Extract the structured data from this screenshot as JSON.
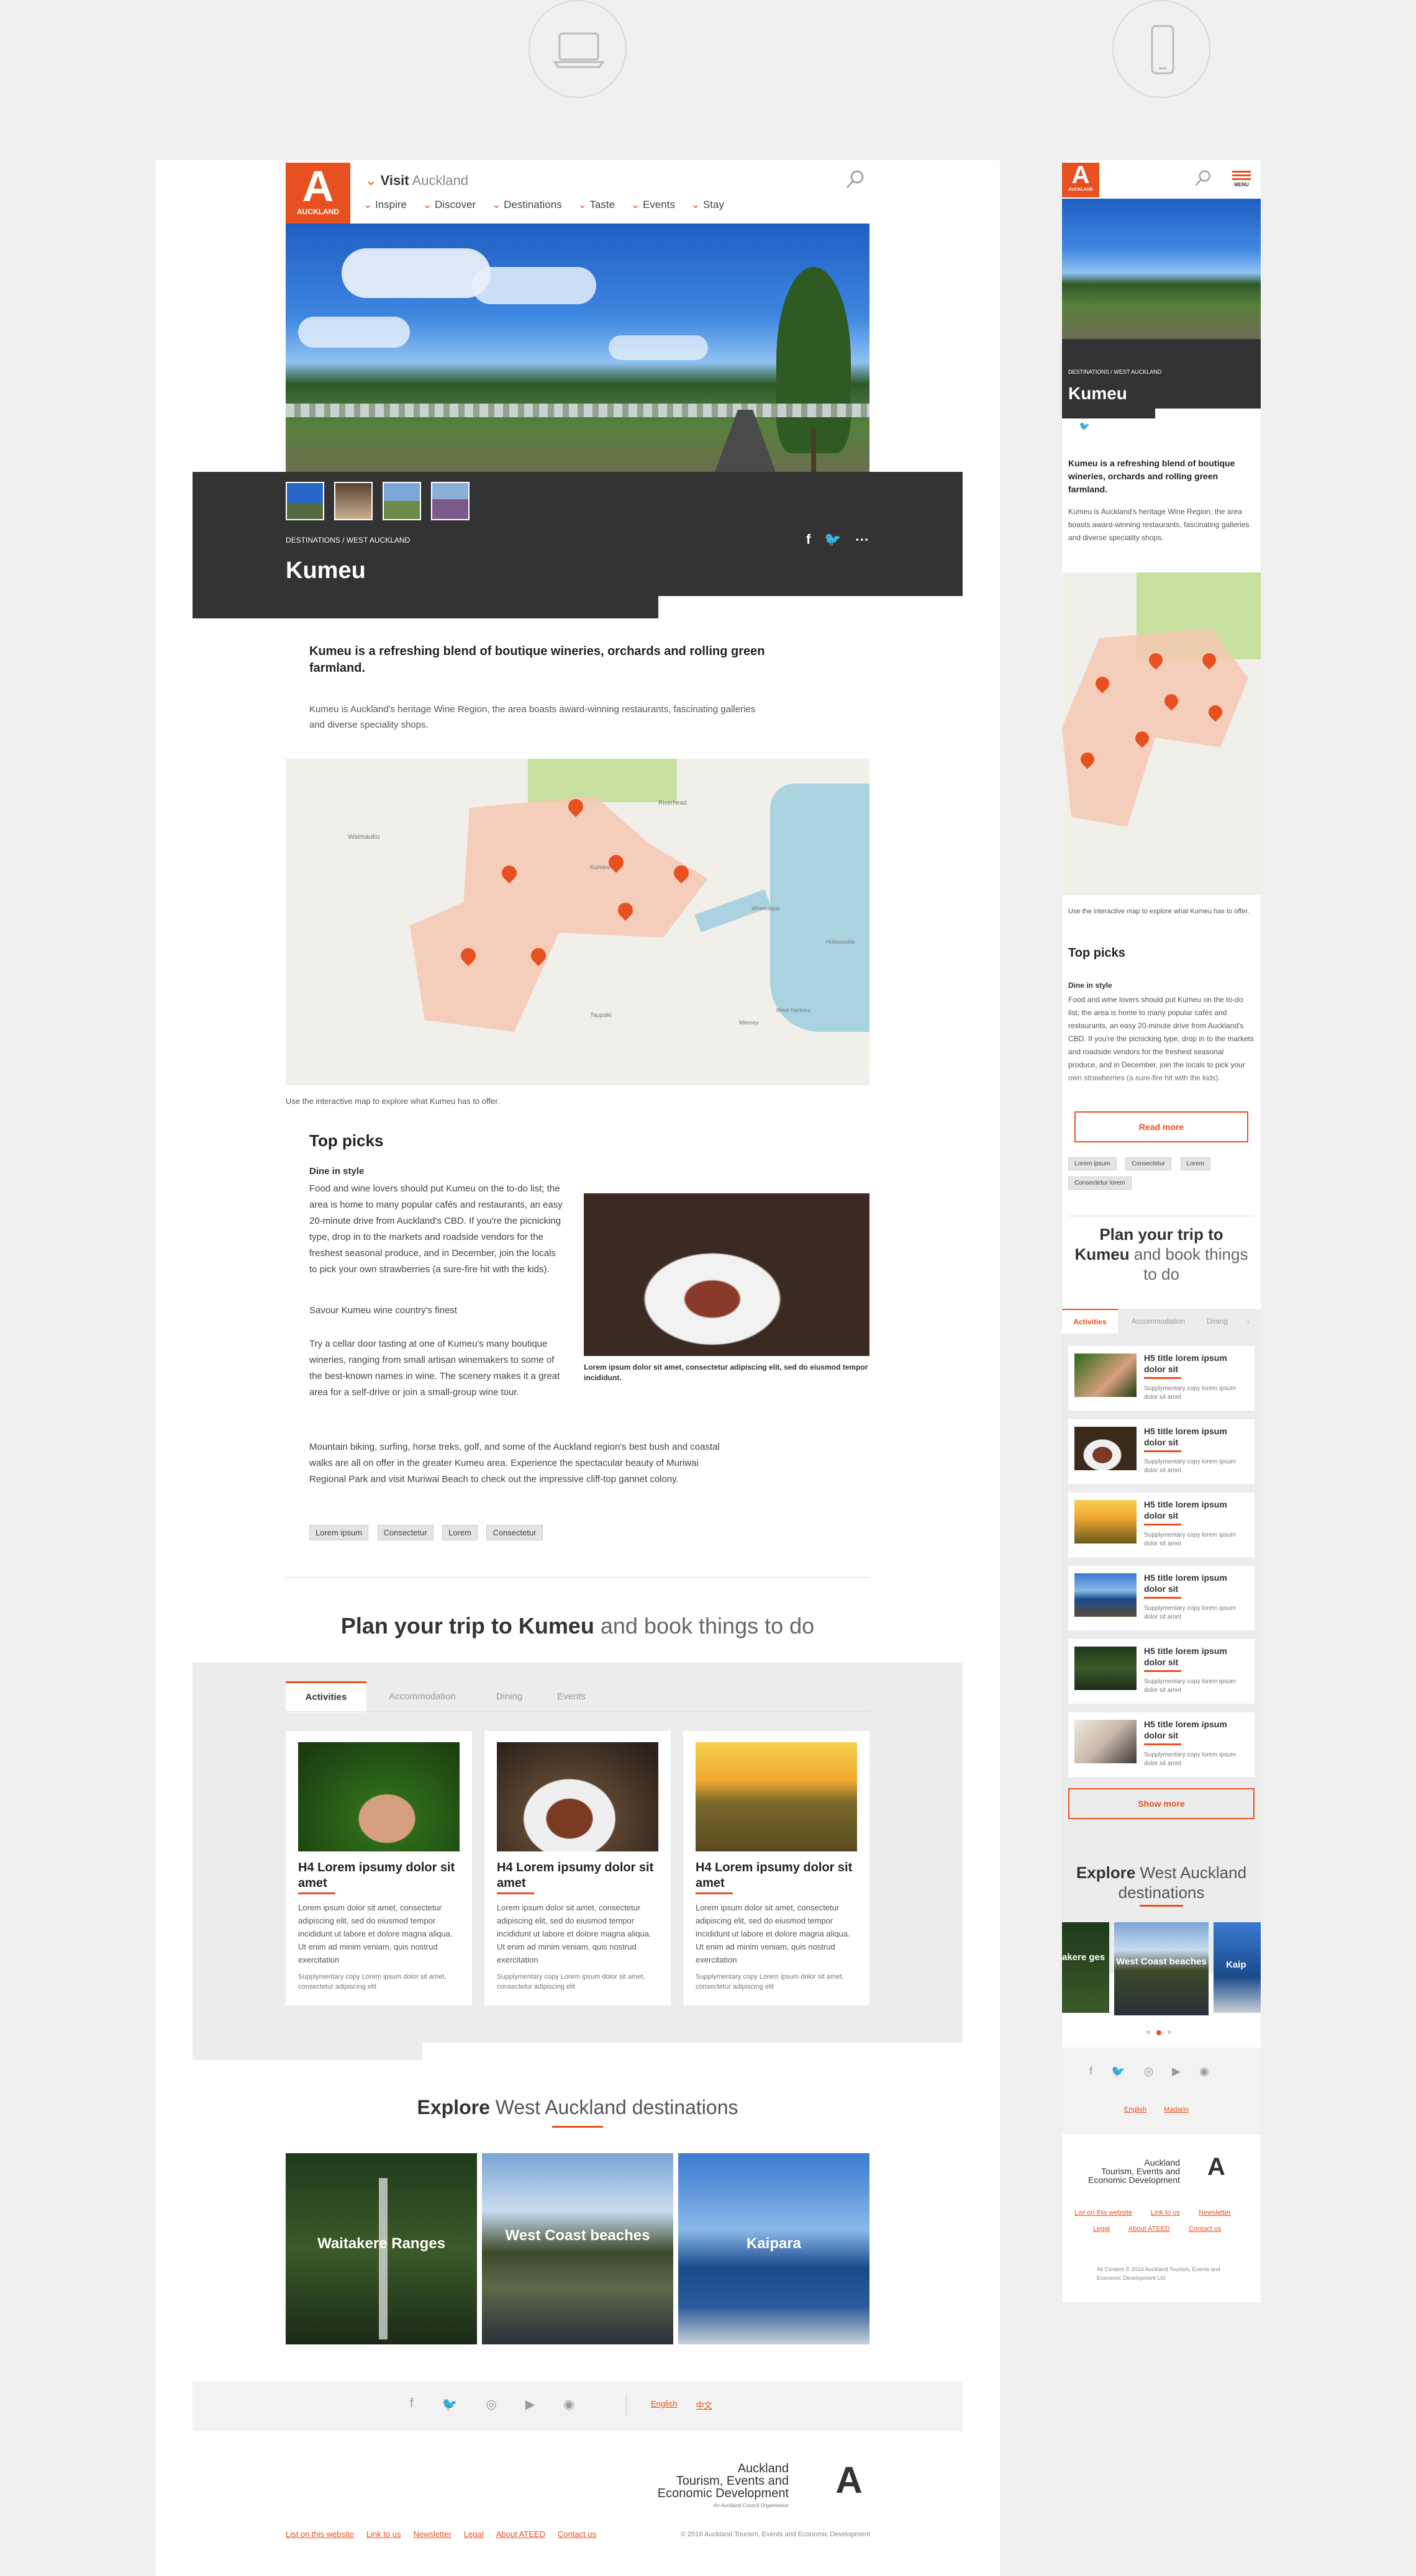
{
  "brand": {
    "logo_text": "AUCKLAND",
    "visit_label": "Visit",
    "visit_sub": "Auckland",
    "accent": "#e8501f",
    "dark": "#333333"
  },
  "nav": [
    "Inspire",
    "Discover",
    "Destinations",
    "Taste",
    "Events",
    "Stay"
  ],
  "hero": {
    "breadcrumb": "DESTINATIONS / WEST AUCKLAND",
    "title": "Kumeu"
  },
  "intro": {
    "lead": "Kumeu is a refreshing blend of boutique wineries, orchards and rolling green farmland.",
    "body": "Kumeu is Auckland's heritage Wine Region, the area boasts award-winning restaurants, fascinating galleries and diverse speciality shops."
  },
  "map": {
    "caption": "Use the interactive map to explore what Kumeu has to offer.",
    "labels": [
      "Waimauku",
      "Riverhead",
      "Kumeu",
      "Taupaki",
      "Whenuapai",
      "Hobsonville",
      "Massey",
      "West Harbour"
    ]
  },
  "top_picks": {
    "heading": "Top picks",
    "subheading": "Dine in style",
    "p1": "Food and wine lovers should put Kumeu on the to-do list; the area is home to many popular cafés and restaurants, an easy 20-minute drive from Auckland's CBD. If you're the picnicking type, drop in to the markets and roadside vendors for the freshest seasonal produce, and in December, join the locals to pick your own strawberries (a sure-fire hit with the kids).",
    "p2": "Savour Kumeu wine country's finest",
    "p3": "Try a cellar door tasting at one of Kumeu's many boutique wineries, ranging from small artisan winemakers to some of the best-known names in wine. The scenery makes it a great area for a self-drive or join a small-group wine tour.",
    "p4": "Mountain biking, surfing, horse treks, golf, and some of the Auckland region's best bush and coastal walks are all on offer in the greater Kumeu area. Experience the spectacular beauty of Muriwai Regional Park and visit Muriwai Beach to check out the impressive cliff-top gannet colony.",
    "img_caption": "Lorem ipsum dolor sit amet, consectetur adipiscing elit, sed do eiusmod tempor incididunt.",
    "tags": [
      "Lorem ipsum",
      "Consectetur",
      "Lorem",
      "Consectetur"
    ]
  },
  "plan": {
    "bold1": "Plan your trip to",
    "bold2": "Kumeu",
    "rest": "and book things to do"
  },
  "tabs": [
    "Activities",
    "Accommodation",
    "Dining",
    "Events"
  ],
  "cards": [
    {
      "title": "H4 Lorem ipsumy dolor sit amet",
      "body": "Lorem ipsum dolor sit amet, consectetur adipiscing elit, sed do eiusmod tempor incididunt ut labore et dolore magna aliqua. Ut enim ad minim veniam, quis nostrud exercitation",
      "small": "Supplymentary copy Lorem ipsum dolor sit amet, consectetur adipiscing elit"
    },
    {
      "title": "H4 Lorem ipsumy dolor sit amet",
      "body": "Lorem ipsum dolor sit amet, consectetur adipiscing elit, sed do eiusmod tempor incididunt ut labore et dolore magna aliqua. Ut enim ad minim veniam, quis nostrud exercitation",
      "small": "Supplymentary copy Lorem ipsum dolor sit amet, consectetur adipiscing elit"
    },
    {
      "title": "H4 Lorem ipsumy dolor sit amet",
      "body": "Lorem ipsum dolor sit amet, consectetur adipiscing elit, sed do eiusmod tempor incididunt ut labore et dolore magna aliqua. Ut enim ad minim veniam, quis nostrud exercitation",
      "small": "Supplymentary copy Lorem ipsum dolor sit amet, consectetur adipiscing elit"
    }
  ],
  "explore": {
    "bold": "Explore",
    "rest": "West Auckland destinations",
    "items": [
      "Waitakere Ranges",
      "West Coast beaches",
      "Kaipara"
    ],
    "mobile_items": [
      "akere ges",
      "West Coast beaches",
      "Kaip"
    ]
  },
  "footer": {
    "lang": [
      "English",
      "中文"
    ],
    "org": [
      "Auckland",
      "Tourism, Events and",
      "Economic Development"
    ],
    "org_sub": "An Auckland Council Organisation",
    "links": [
      "List on this website",
      "Link to us",
      "Newsletter",
      "Legal",
      "About ATEED",
      "Contact us"
    ],
    "copyright": "© 2016 Auckland Tourism, Events and Economic Development"
  },
  "mobile": {
    "menu": "MENU",
    "read_more": "Read more",
    "tags": [
      "Lorem ipsum",
      "Consectetur",
      "Lorem",
      "Consectetur lorem"
    ],
    "plan": {
      "bold1": "Plan your trip to",
      "bold2": "Kumeu",
      "rest": "and book things to do"
    },
    "tabs": [
      "Activities",
      "Accommodation",
      "Dining"
    ],
    "list_title": "H5 title lorem ipsum dolor sit",
    "list_small": "Supplymentary copy lorem ipsum dolor sit amet",
    "show_more": "Show more",
    "explore_bold": "Explore",
    "explore_rest": "West Auckland destinations",
    "lang": [
      "English",
      "Madarin"
    ],
    "links": [
      "List on this website",
      "Link to us",
      "Newsletter",
      "Legal",
      "About ATEED",
      "Contact us"
    ],
    "copyright": "All Content © 2014 Auckland Tourism, Events and Economic Development Ltd",
    "p1": "Food and wine lovers should put Kumeu on the to-do list; the area is home to many popular cafés and restaurants, an easy 20-minute drive from Auckland's CBD. If you're the picnicking type, drop in to the markets and roadside vendors for the freshest seasonal produce, and in December, join the locals to pick your own strawberries (a sure-fire hit with the kids)."
  }
}
